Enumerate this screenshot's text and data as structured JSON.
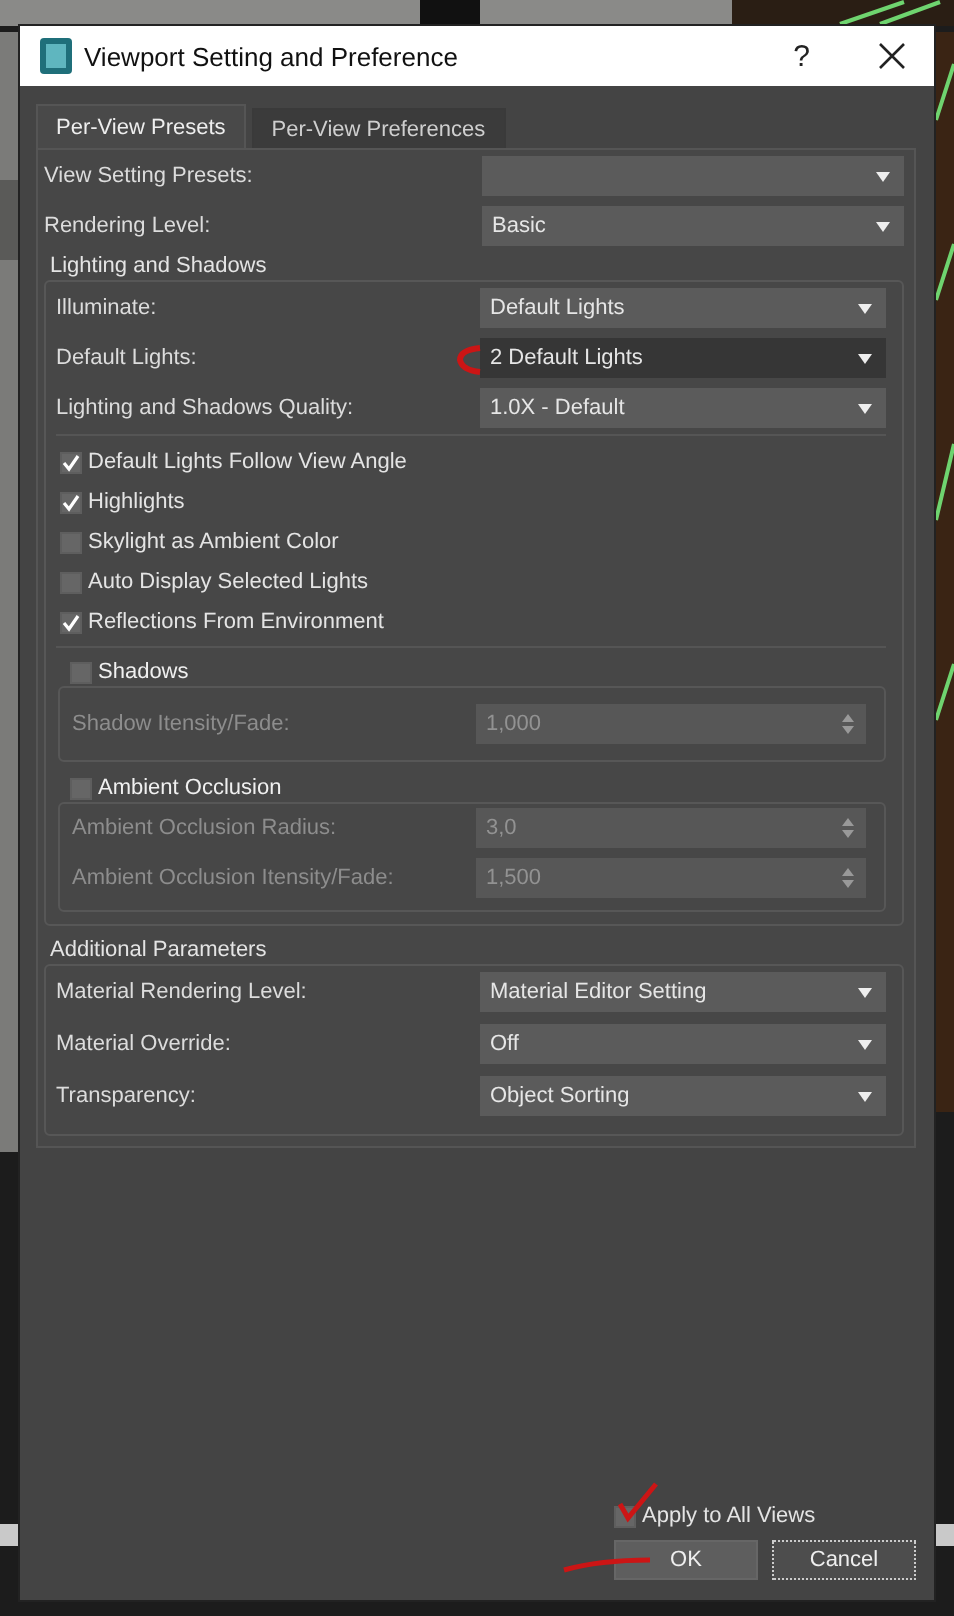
{
  "window": {
    "title": "Viewport Setting and Preference",
    "help": "?"
  },
  "tabs": [
    {
      "label": "Per-View Presets",
      "selected": true
    },
    {
      "label": "Per-View Preferences",
      "selected": false
    }
  ],
  "preset_rows": [
    {
      "label": "View Setting Presets:",
      "highlighted": false
    },
    {
      "label": "Rendering Level:",
      "value": "Basic",
      "highlighted": false
    }
  ],
  "lighting_group": {
    "title": "Lighting and Shadows",
    "dropdowns": [
      {
        "label": "Illuminate:",
        "value": "Default Lights",
        "highlighted": false
      },
      {
        "label": "Default Lights:",
        "value": "2 Default Lights",
        "highlighted": true
      },
      {
        "label": "Lighting and Shadows Quality:",
        "value": "1.0X - Default",
        "highlighted": false
      }
    ],
    "checkboxes": [
      {
        "label": "Default Lights Follow View Angle",
        "checked": true
      },
      {
        "label": "Highlights",
        "checked": true
      },
      {
        "label": "Skylight as Ambient Color",
        "checked": false
      },
      {
        "label": "Auto Display Selected Lights",
        "checked": false
      },
      {
        "label": "Reflections From Environment",
        "checked": true
      }
    ],
    "subgroups": [
      {
        "title": "Shadows",
        "checked": false,
        "fields": [
          {
            "label": "Shadow Itensity/Fade:",
            "value": "1,000",
            "disabled": true
          }
        ]
      },
      {
        "title": "Ambient Occlusion",
        "checked": false,
        "fields": [
          {
            "label": "Ambient Occlusion Radius:",
            "value": "3,0",
            "disabled": true
          },
          {
            "label": "Ambient Occlusion Itensity/Fade:",
            "value": "1,500",
            "disabled": true
          }
        ]
      }
    ]
  },
  "additional_group": {
    "title": "Additional Parameters",
    "dropdowns": [
      {
        "label": "Material Rendering Level:",
        "value": "Material Editor Setting",
        "highlighted": false
      },
      {
        "label": "Material Override:",
        "value": "Off",
        "highlighted": false
      },
      {
        "label": "Transparency:",
        "value": "Object Sorting",
        "highlighted": false
      }
    ]
  },
  "footer": {
    "apply": {
      "label": "Apply to All Views",
      "checked": false
    },
    "buttons": [
      {
        "label": "OK",
        "focused": false
      },
      {
        "label": "Cancel",
        "focused": true
      }
    ]
  }
}
